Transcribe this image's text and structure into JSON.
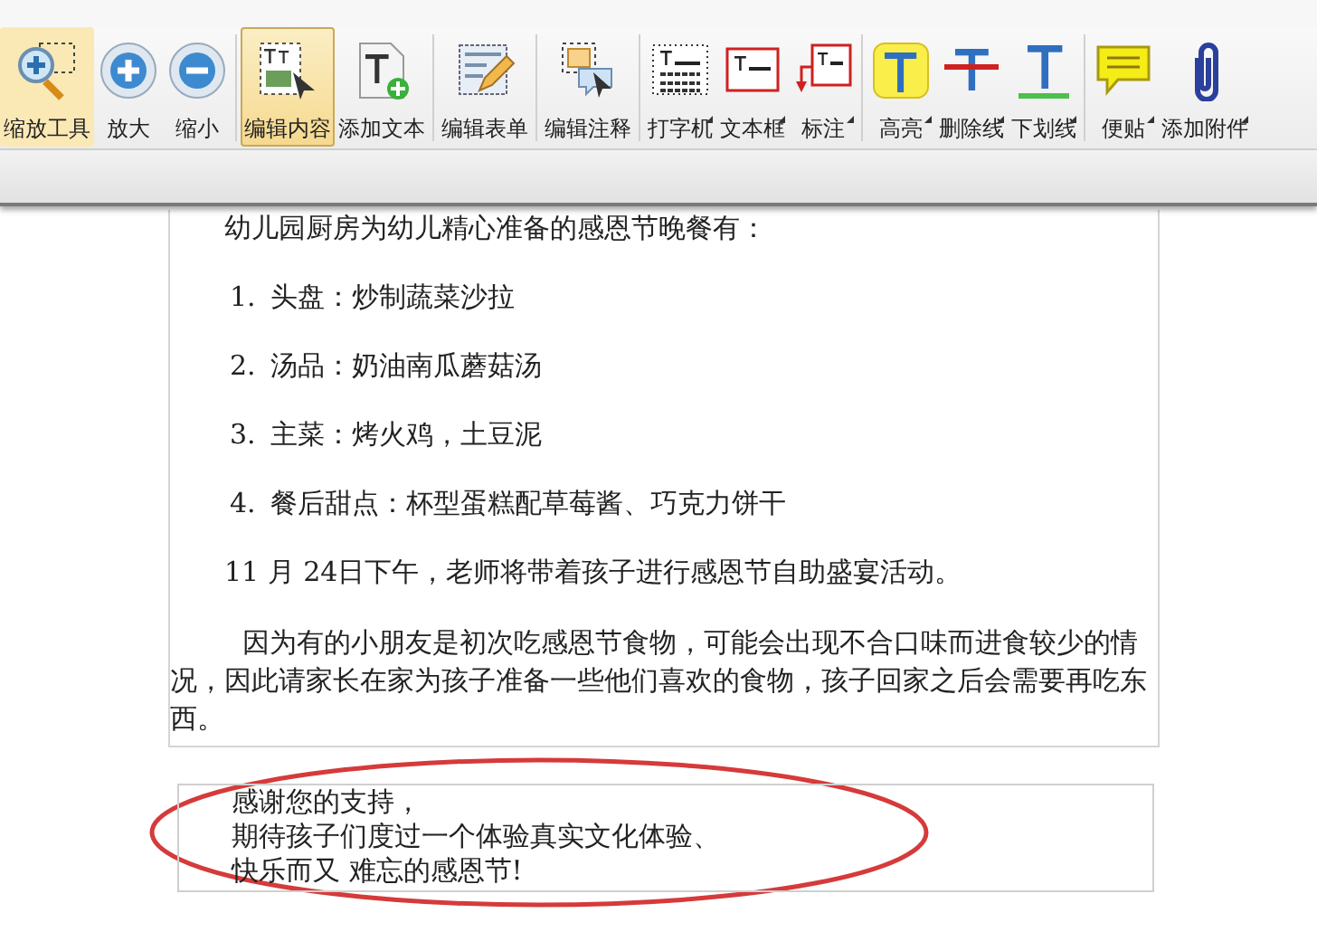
{
  "toolbar": {
    "groups": [
      {
        "items": [
          {
            "kind": "zoom-tool",
            "label": "缩放工具",
            "selected": true,
            "dropdown": false
          },
          {
            "kind": "zoom-in",
            "label": "放大",
            "selected": false,
            "dropdown": false
          },
          {
            "kind": "zoom-out",
            "label": "缩小",
            "selected": false,
            "dropdown": false
          }
        ]
      },
      {
        "items": [
          {
            "kind": "edit-content",
            "label": "编辑内容",
            "selected": true,
            "dropdown": false
          },
          {
            "kind": "add-text",
            "label": "添加文本",
            "selected": false,
            "dropdown": false
          }
        ]
      },
      {
        "items": [
          {
            "kind": "edit-form",
            "label": "编辑表单",
            "selected": false,
            "dropdown": false
          }
        ]
      },
      {
        "items": [
          {
            "kind": "edit-annotation",
            "label": "编辑注释",
            "selected": false,
            "dropdown": false
          }
        ]
      },
      {
        "items": [
          {
            "kind": "typewriter",
            "label": "打字机",
            "selected": false,
            "dropdown": true
          },
          {
            "kind": "textbox",
            "label": "文本框",
            "selected": false,
            "dropdown": true
          },
          {
            "kind": "callout",
            "label": "标注",
            "selected": false,
            "dropdown": true
          }
        ]
      },
      {
        "items": [
          {
            "kind": "highlight",
            "label": "高亮",
            "selected": false,
            "dropdown": true
          },
          {
            "kind": "strikeout",
            "label": "删除线",
            "selected": false,
            "dropdown": true
          },
          {
            "kind": "underline",
            "label": "下划线",
            "selected": false,
            "dropdown": true
          }
        ]
      },
      {
        "items": [
          {
            "kind": "note",
            "label": "便贴",
            "selected": false,
            "dropdown": true
          },
          {
            "kind": "attach",
            "label": "添加附件",
            "selected": false,
            "dropdown": true
          }
        ]
      }
    ]
  },
  "document": {
    "blocks": [
      {
        "kind": "paragraph",
        "text": "幼儿园厨房为幼儿精心准备的感恩节晚餐有："
      },
      {
        "kind": "list-item",
        "number": "1.",
        "text": "头盘：炒制蔬菜沙拉"
      },
      {
        "kind": "list-item",
        "number": "2.",
        "text": "汤品：奶油南瓜蘑菇汤"
      },
      {
        "kind": "list-item",
        "number": "3.",
        "text": "主菜：烤火鸡，土豆泥"
      },
      {
        "kind": "list-item",
        "number": "4.",
        "text": "餐后甜点：杯型蛋糕配草莓酱、巧克力饼干"
      },
      {
        "kind": "paragraph",
        "text": "11 月 24日下午，老师将带着孩子进行感恩节自助盛宴活动。"
      },
      {
        "kind": "paragraph",
        "text": "因为有的小朋友是初次吃感恩节食物，可能会出现不合口味而进食较少的情况，因此请家长在家为孩子准备一些他们喜欢的食物，孩子回家之后会需要再吃东西。"
      }
    ],
    "text_box": {
      "lines": [
        "感谢您的支持，",
        "期待孩子们度过一个体验真实文化体验、",
        "快乐而又 难忘的感恩节!"
      ]
    }
  }
}
